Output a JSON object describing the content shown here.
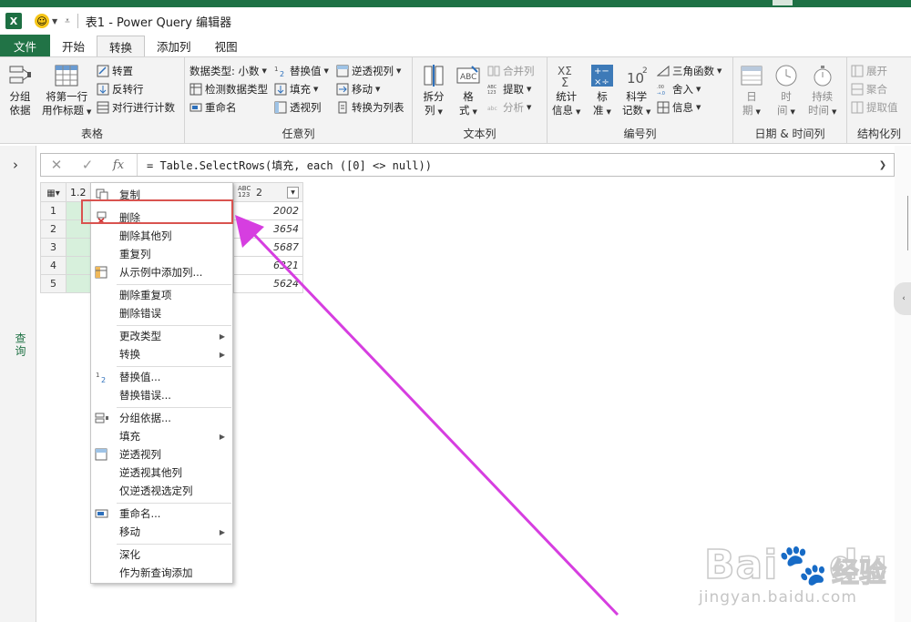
{
  "window": {
    "title": "表1 - Power Query 编辑器",
    "app_icon": "excel-icon",
    "quick_access_icon": "smiley-icon"
  },
  "tabs": [
    {
      "label": "文件",
      "kind": "file"
    },
    {
      "label": "开始"
    },
    {
      "label": "转换",
      "active": true
    },
    {
      "label": "添加列"
    },
    {
      "label": "视图"
    }
  ],
  "ribbon": {
    "table_group": {
      "label": "表格",
      "group_by_line1": "分组",
      "group_by_line2": "依据",
      "first_row_line1": "将第一行",
      "first_row_line2": "用作标题",
      "transpose": "转置",
      "reverse_rows": "反转行",
      "count_rows": "对行进行计数"
    },
    "any_column_group": {
      "label": "任意列",
      "data_type": "数据类型: 小数",
      "detect_type": "检测数据类型",
      "rename": "重命名",
      "replace_values": "替换值",
      "fill": "填充",
      "pivot": "透视列",
      "unpivot": "逆透视列",
      "move": "移动",
      "convert_to_list": "转换为列表"
    },
    "text_group": {
      "label": "文本列",
      "split_line1": "拆分",
      "split_line2": "列",
      "format_line1": "格",
      "format_line2": "式",
      "merge": "合并列",
      "extract": "提取",
      "parse": "分析"
    },
    "number_group": {
      "label": "编号列",
      "stats_line1": "统计",
      "stats_line2": "信息",
      "standard_line1": "标",
      "standard_line2": "准",
      "scientific_line1": "科学",
      "scientific_line2": "记数",
      "trig": "三角函数",
      "rounding": "舍入",
      "info": "信息"
    },
    "datetime_group": {
      "label": "日期 & 时间列",
      "date_line1": "日",
      "date_line2": "期",
      "time_line1": "时",
      "time_line2": "间",
      "duration_line1": "持续",
      "duration_line2": "时间"
    },
    "structured_group": {
      "label": "结构化列",
      "expand": "展开",
      "aggregate": "聚合",
      "extract_values": "提取值"
    }
  },
  "nav": {
    "label": "查询"
  },
  "formula": {
    "text": "= Table.SelectRows(填充, each ([0] <> null))",
    "fx_label": "fx"
  },
  "grid": {
    "header_col1_type": "1.2",
    "header_col2_name": "1",
    "header_col3_type": "ABC 123",
    "header_col3_name": "2",
    "rows": [
      {
        "num": "1",
        "val": "2002"
      },
      {
        "num": "2",
        "val": "3654"
      },
      {
        "num": "3",
        "val": "5687"
      },
      {
        "num": "4",
        "val": "6321"
      },
      {
        "num": "5",
        "val": "5624"
      }
    ]
  },
  "context_menu": {
    "items": [
      {
        "label": "复制"
      },
      {
        "label": "删除"
      },
      {
        "label": "删除其他列"
      },
      {
        "label": "重复列"
      },
      {
        "label": "从示例中添加列..."
      },
      {
        "label": "删除重复项"
      },
      {
        "label": "删除错误"
      },
      {
        "label": "更改类型"
      },
      {
        "label": "转换"
      },
      {
        "label": "替换值..."
      },
      {
        "label": "替换错误..."
      },
      {
        "label": "分组依据..."
      },
      {
        "label": "填充"
      },
      {
        "label": "逆透视列"
      },
      {
        "label": "逆透视其他列"
      },
      {
        "label": "仅逆透视选定列"
      },
      {
        "label": "重命名..."
      },
      {
        "label": "移动"
      },
      {
        "label": "深化"
      },
      {
        "label": "作为新查询添加"
      }
    ]
  },
  "annotations": {
    "highlight_color": "#d9534f",
    "arrow_color": "#d63ee0"
  },
  "watermark": {
    "brand": "Bai",
    "brand2": "du",
    "cn": "经验",
    "url": "jingyan.baidu.com"
  }
}
